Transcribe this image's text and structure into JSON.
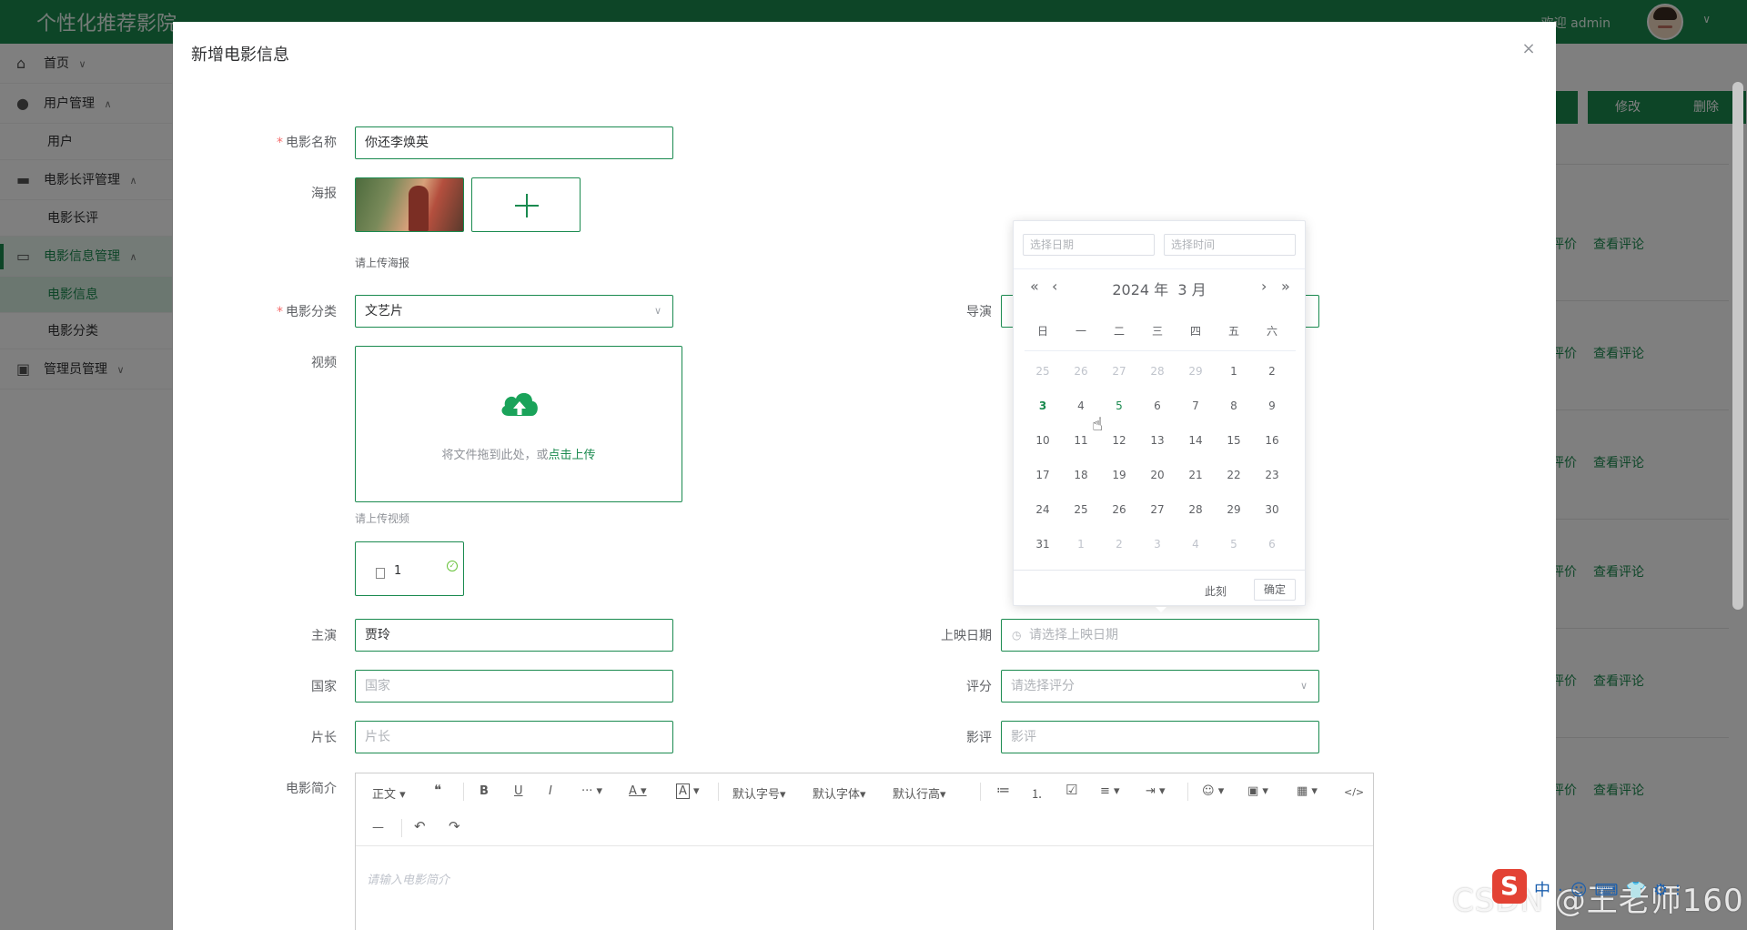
{
  "app": {
    "title": "个性化推荐影院",
    "welcome": "欢迎 admin"
  },
  "sidebar": {
    "items": [
      {
        "label": "首页",
        "icon": "home-icon",
        "caret": "∨"
      },
      {
        "label": "用户管理",
        "icon": "user-icon",
        "caret": "∧"
      },
      {
        "label": "用户",
        "sub": true
      },
      {
        "label": "电影长评管理",
        "icon": "folder-icon",
        "caret": "∧"
      },
      {
        "label": "电影长评",
        "sub": true
      },
      {
        "label": "电影信息管理",
        "icon": "film-icon",
        "caret": "∧"
      },
      {
        "label": "电影信息",
        "sub": true
      },
      {
        "label": "电影分类",
        "sub": true
      },
      {
        "label": "管理员管理",
        "icon": "admin-icon",
        "caret": "∨"
      }
    ]
  },
  "background": {
    "edit_btn": "修改",
    "delete_btn": "删除",
    "row_action_1": "评价",
    "row_action_2": "查看评论"
  },
  "dialog": {
    "title": "新增电影信息",
    "close": "×",
    "fields": {
      "name_label": "电影名称",
      "name_value": "你还李焕英",
      "poster_label": "海报",
      "poster_hint": "请上传海报",
      "category_label": "电影分类",
      "category_value": "文艺片",
      "director_label": "导演",
      "video_label": "视频",
      "video_drop_text": "将文件拖到此处，或",
      "video_drop_link": "点击上传",
      "video_hint": "请上传视频",
      "file_name": "1",
      "actor_label": "主演",
      "actor_value": "贾玲",
      "release_label": "上映日期",
      "release_placeholder": "请选择上映日期",
      "country_label": "国家",
      "country_placeholder": "国家",
      "rating_label": "评分",
      "rating_placeholder": "请选择评分",
      "duration_label": "片长",
      "duration_placeholder": "片长",
      "review_label": "影评",
      "review_placeholder": "影评",
      "intro_label": "电影简介",
      "intro_placeholder": "请输入电影简介"
    },
    "editor_toolbar": {
      "paragraph": "正文",
      "quote": "❝",
      "bold": "B",
      "underline": "U",
      "italic": "I",
      "more": "···",
      "font_color": "A",
      "bg_color": "A",
      "font_size": "默认字号",
      "font_family": "默认字体",
      "line_height": "默认行高",
      "bullet_list": "≔",
      "numbered_list": "⒈",
      "todo": "☑",
      "align": "≡",
      "indent": "⇥",
      "emoji": "☺",
      "image": "▣",
      "table": "▦",
      "code": "</>",
      "divider": "—",
      "undo": "↶",
      "redo": "↷"
    }
  },
  "date_picker": {
    "date_placeholder": "选择日期",
    "time_placeholder": "选择时间",
    "year_label": "2024 年",
    "month_label": "3 月",
    "prev_year": "«",
    "prev_month": "‹",
    "next_month": "›",
    "next_year": "»",
    "weekdays": [
      "日",
      "一",
      "二",
      "三",
      "四",
      "五",
      "六"
    ],
    "rows": [
      [
        "25",
        "26",
        "27",
        "28",
        "29",
        "1",
        "2"
      ],
      [
        "3",
        "4",
        "5",
        "6",
        "7",
        "8",
        "9"
      ],
      [
        "10",
        "11",
        "12",
        "13",
        "14",
        "15",
        "16"
      ],
      [
        "17",
        "18",
        "19",
        "20",
        "21",
        "22",
        "23"
      ],
      [
        "24",
        "25",
        "26",
        "27",
        "28",
        "29",
        "30"
      ],
      [
        "31",
        "1",
        "2",
        "3",
        "4",
        "5",
        "6"
      ]
    ],
    "now_btn": "此刻",
    "ok_btn": "确定"
  },
  "watermark": "CSDN @王老师160",
  "ime": {
    "logo": "S",
    "items": "中·☺⌨👕⚙⁝"
  },
  "colors": {
    "brand": "#1a8a4f",
    "required": "#f56c6c"
  }
}
